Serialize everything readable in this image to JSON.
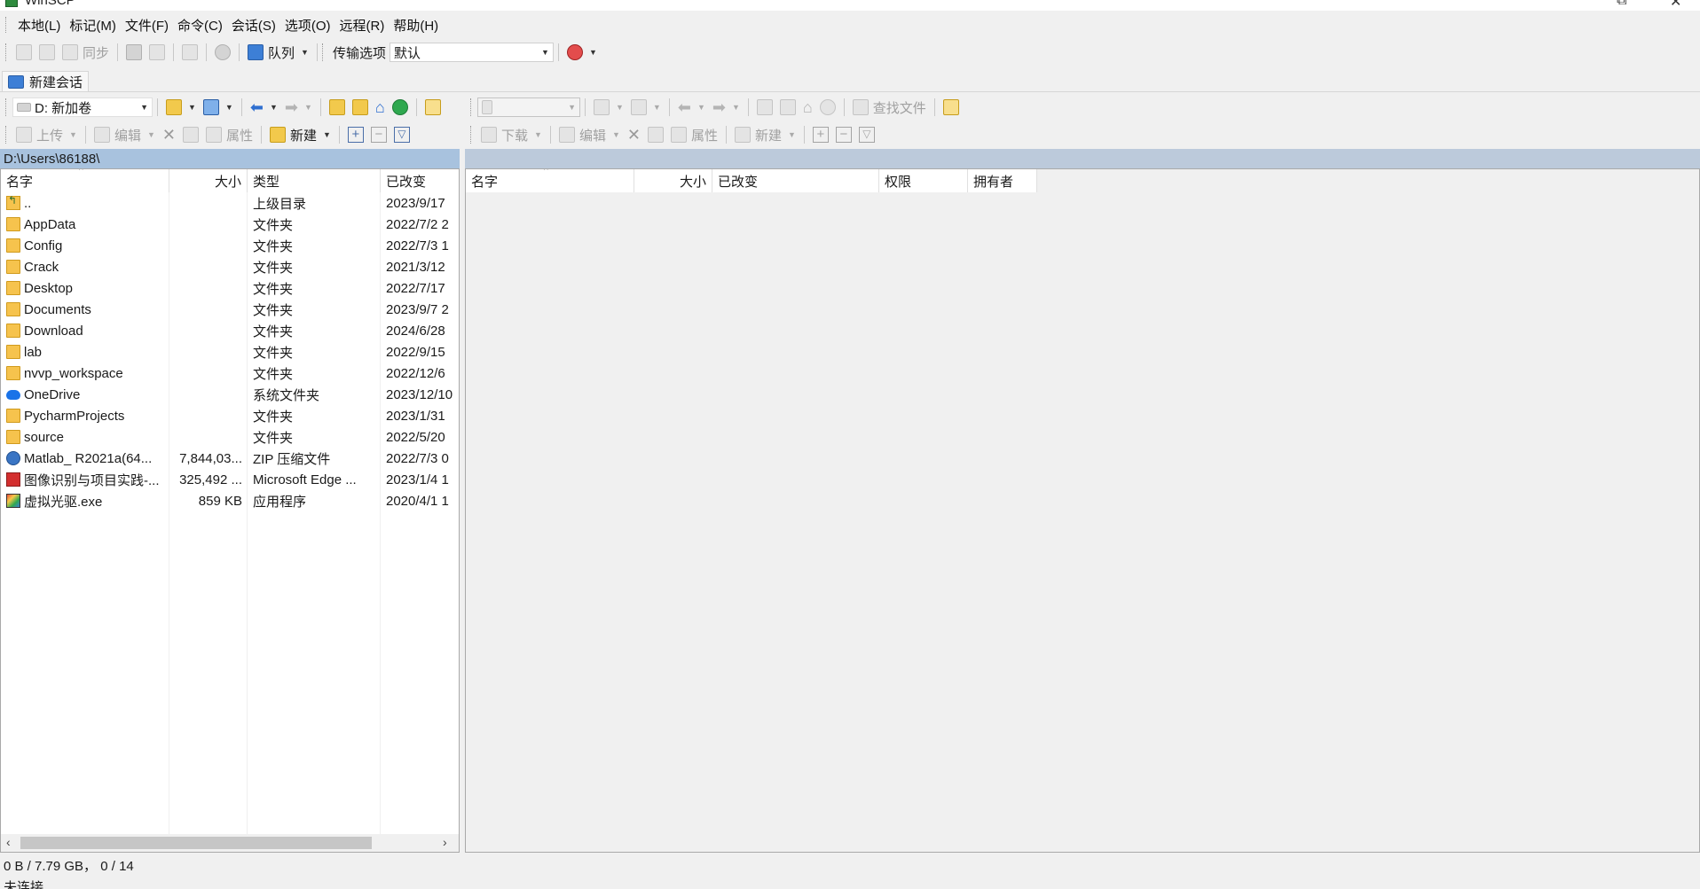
{
  "window": {
    "title": "WinSCP",
    "restore_glyph": "⧉",
    "close_glyph": "✕"
  },
  "menu": [
    "本地(L)",
    "标记(M)",
    "文件(F)",
    "命令(C)",
    "会话(S)",
    "选项(O)",
    "远程(R)",
    "帮助(H)"
  ],
  "main_toolbar": {
    "sync_label": "同步",
    "queue_label": "队列",
    "transfer_options_label": "传输选项",
    "transfer_preset": "默认"
  },
  "session_tab": {
    "label": "新建会话"
  },
  "local": {
    "drive": "D: 新加卷",
    "path": "D:\\Users\\86188\\",
    "toolbar": {
      "upload_label": "上传",
      "edit_label": "编辑",
      "properties_label": "属性",
      "new_label": "新建"
    },
    "columns": {
      "name": "名字",
      "size": "大小",
      "type": "类型",
      "changed": "已改变"
    },
    "files": [
      {
        "icon": "parent-dir-icon",
        "name": "..",
        "size": "",
        "type": "上级目录",
        "changed": "2023/9/17"
      },
      {
        "icon": "folder-icon",
        "name": "AppData",
        "size": "",
        "type": "文件夹",
        "changed": "2022/7/2 2"
      },
      {
        "icon": "folder-icon",
        "name": "Config",
        "size": "",
        "type": "文件夹",
        "changed": "2022/7/3 1"
      },
      {
        "icon": "folder-icon",
        "name": "Crack",
        "size": "",
        "type": "文件夹",
        "changed": "2021/3/12"
      },
      {
        "icon": "folder-icon",
        "name": "Desktop",
        "size": "",
        "type": "文件夹",
        "changed": "2022/7/17"
      },
      {
        "icon": "folder-icon",
        "name": "Documents",
        "size": "",
        "type": "文件夹",
        "changed": "2023/9/7 2"
      },
      {
        "icon": "folder-icon",
        "name": "Download",
        "size": "",
        "type": "文件夹",
        "changed": "2024/6/28"
      },
      {
        "icon": "folder-icon",
        "name": "lab",
        "size": "",
        "type": "文件夹",
        "changed": "2022/9/15"
      },
      {
        "icon": "folder-icon",
        "name": "nvvp_workspace",
        "size": "",
        "type": "文件夹",
        "changed": "2022/12/6"
      },
      {
        "icon": "onedrive-icon",
        "name": "OneDrive",
        "size": "",
        "type": "系统文件夹",
        "changed": "2023/12/10"
      },
      {
        "icon": "folder-icon",
        "name": "PycharmProjects",
        "size": "",
        "type": "文件夹",
        "changed": "2023/1/31"
      },
      {
        "icon": "folder-icon",
        "name": "source",
        "size": "",
        "type": "文件夹",
        "changed": "2022/5/20"
      },
      {
        "icon": "zip-file-icon",
        "name": "Matlab_ R2021a(64...",
        "size": "7,844,03...",
        "type": "ZIP 压缩文件",
        "changed": "2022/7/3 0"
      },
      {
        "icon": "pdf-file-icon",
        "name": "图像识别与项目实践-...",
        "size": "325,492 ...",
        "type": "Microsoft Edge ...",
        "changed": "2023/1/4 1"
      },
      {
        "icon": "exe-file-icon",
        "name": "虚拟光驱.exe",
        "size": "859 KB",
        "type": "应用程序",
        "changed": "2020/4/1 1"
      }
    ]
  },
  "remote": {
    "toolbar": {
      "find_files_label": "查找文件",
      "download_label": "下载",
      "edit_label": "编辑",
      "properties_label": "属性",
      "new_label": "新建"
    },
    "columns": {
      "name": "名字",
      "size": "大小",
      "changed": "已改变",
      "rights": "权限",
      "owner": "拥有者"
    }
  },
  "status": {
    "selection": "0 B / 7.79 GB，  0 / 14",
    "connection": "未连接"
  },
  "colors": {
    "path_bar_local": "#a8c2de",
    "path_bar_remote": "#bccadb",
    "folder": "#f6c34d"
  }
}
